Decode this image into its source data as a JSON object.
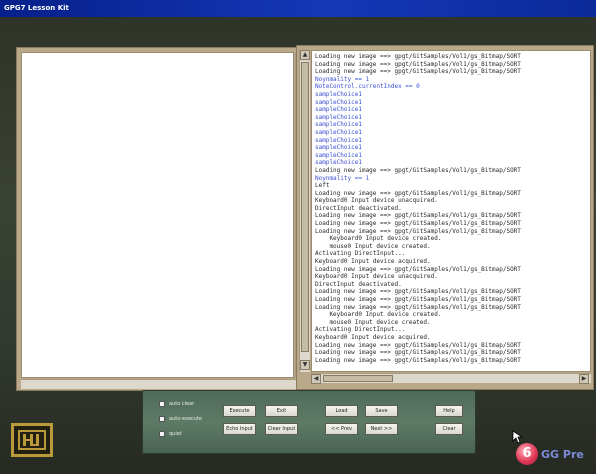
{
  "window": {
    "title": "GPG7   Lesson Kit"
  },
  "log": {
    "lines": [
      {
        "text": "Loading new image ==> gpgt/GitSamples/Vol1/gs_Bitmap/SORT",
        "color": "normal"
      },
      {
        "text": "Loading new image ==> gpgt/GitSamples/Vol1/gs_Bitmap/SORT",
        "color": "normal"
      },
      {
        "text": "Loading new image ==> gpgt/GitSamples/Vol1/gs_Bitmap/SORT",
        "color": "normal"
      },
      {
        "text": "Noynmality == 1",
        "color": "blue"
      },
      {
        "text": "NoteControl.currentIndex == 0",
        "color": "blue"
      },
      {
        "text": "sampleChoice1",
        "color": "blue"
      },
      {
        "text": "sampleChoice1",
        "color": "blue"
      },
      {
        "text": "sampleChoice1",
        "color": "blue"
      },
      {
        "text": "sampleChoice1",
        "color": "blue"
      },
      {
        "text": "sampleChoice1",
        "color": "blue"
      },
      {
        "text": "sampleChoice1",
        "color": "blue"
      },
      {
        "text": "sampleChoice1",
        "color": "blue"
      },
      {
        "text": "sampleChoice1",
        "color": "blue"
      },
      {
        "text": "sampleChoice1",
        "color": "blue"
      },
      {
        "text": "sampleChoice1",
        "color": "blue"
      },
      {
        "text": "Loading new image ==> gpgt/GitSamples/Vol1/gs_Bitmap/SORT",
        "color": "normal"
      },
      {
        "text": "Noynmality == 1",
        "color": "blue"
      },
      {
        "text": "Left",
        "color": "normal"
      },
      {
        "text": "Loading new image ==> gpgt/GitSamples/Vol1/gs_Bitmap/SORT",
        "color": "normal"
      },
      {
        "text": "Keyboard0 Input device unacquired.",
        "color": "normal"
      },
      {
        "text": "DirectInput deactivated.",
        "color": "normal"
      },
      {
        "text": "Loading new image ==> gpgt/GitSamples/Vol1/gs_Bitmap/SORT",
        "color": "normal"
      },
      {
        "text": "Loading new image ==> gpgt/GitSamples/Vol1/gs_Bitmap/SORT",
        "color": "normal"
      },
      {
        "text": "Loading new image ==> gpgt/GitSamples/Vol1/gs_Bitmap/SORT",
        "color": "normal"
      },
      {
        "text": "    Keyboard0 Input device created.",
        "color": "normal"
      },
      {
        "text": "    mouse0 Input device created.",
        "color": "normal"
      },
      {
        "text": "Activating DirectInput...",
        "color": "normal"
      },
      {
        "text": "Keyboard0 Input device acquired.",
        "color": "normal"
      },
      {
        "text": "Loading new image ==> gpgt/GitSamples/Vol1/gs_Bitmap/SORT",
        "color": "normal"
      },
      {
        "text": "Keyboard0 Input device unacquired.",
        "color": "normal"
      },
      {
        "text": "DirectInput deactivated.",
        "color": "normal"
      },
      {
        "text": "Loading new image ==> gpgt/GitSamples/Vol1/gs_Bitmap/SORT",
        "color": "normal"
      },
      {
        "text": "Loading new image ==> gpgt/GitSamples/Vol1/gs_Bitmap/SORT",
        "color": "normal"
      },
      {
        "text": "Loading new image ==> gpgt/GitSamples/Vol1/gs_Bitmap/SORT",
        "color": "normal"
      },
      {
        "text": "    Keyboard0 Input device created.",
        "color": "normal"
      },
      {
        "text": "    mouse0 Input device created.",
        "color": "normal"
      },
      {
        "text": "Activating DirectInput...",
        "color": "normal"
      },
      {
        "text": "Keyboard0 Input device acquired.",
        "color": "normal"
      },
      {
        "text": "Loading new image ==> gpgt/GitSamples/Vol1/gs_Bitmap/SORT",
        "color": "normal"
      },
      {
        "text": "Loading new image ==> gpgt/GitSamples/Vol1/gs_Bitmap/SORT",
        "color": "normal"
      },
      {
        "text": "Loading new image ==> gpgt/GitSamples/Vol1/gs_Bitmap/SORT",
        "color": "normal"
      }
    ]
  },
  "controls": {
    "checkboxes": [
      {
        "label": "auto clear"
      },
      {
        "label": "auto-execute"
      },
      {
        "label": "quiet"
      }
    ],
    "buttons": {
      "execute": "Execute",
      "exit": "Exit",
      "echo_input": "Echo Input",
      "clear_input": "Clear Input",
      "load": "Load",
      "save": "Save",
      "prev": "<< Prev",
      "next": "Next >>",
      "help": "Help",
      "clear": "Clear"
    }
  },
  "branding": {
    "gg_text": "GG Pre"
  },
  "colors": {
    "log_blue": "#3b4fd8",
    "titlebar": "#0a2a98",
    "logo_gold": "#b89a38"
  },
  "icons": [
    "hj-logo-icon",
    "gg-logo-icon",
    "cursor-icon"
  ]
}
